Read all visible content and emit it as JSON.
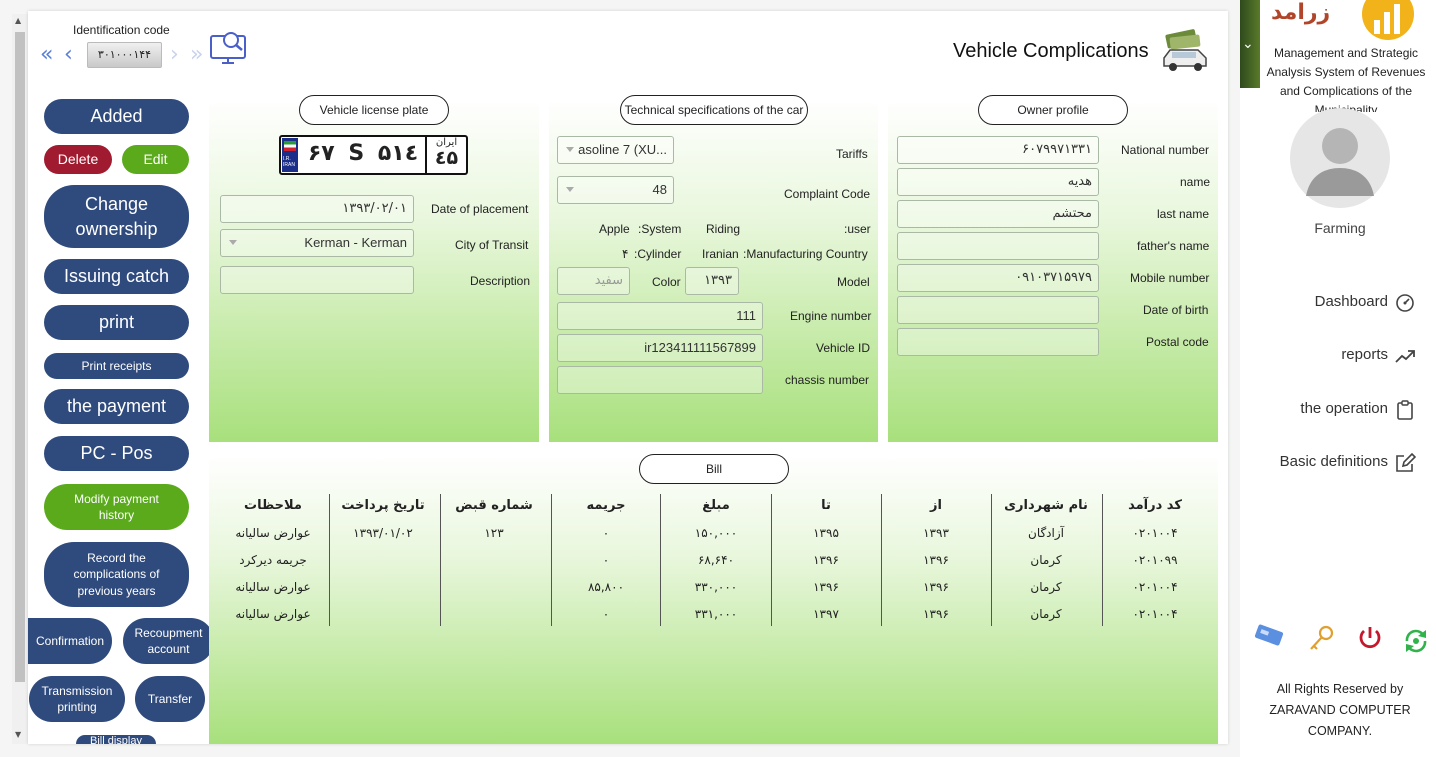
{
  "header": {
    "identification_label": "Identification code",
    "identification_value": "۳۰۱۰۰۰۱۴۴",
    "title": "Vehicle Complications"
  },
  "actions": {
    "added": "Added",
    "delete": "Delete",
    "edit": "Edit",
    "change_ownership": "Change ownership",
    "issuing_catch": "Issuing catch",
    "print": "print",
    "print_receipts": "Print receipts",
    "the_payment": "the payment",
    "pc_pos": "PC - Pos",
    "modify_payment_history": "Modify payment history",
    "record_complications": "Record the complications of previous years",
    "confirmation": "Confirmation",
    "recoupment_account": "Recoupment account",
    "transmission_printing": "Transmission printing",
    "transfer": "Transfer",
    "bill_display": "Bill display"
  },
  "plate_panel": {
    "title": "Vehicle license plate",
    "plate_num1": "۶۷",
    "plate_letter": "S",
    "plate_num2": "۵۱٤",
    "plate_region_label": "ایران",
    "plate_region": "٤۵",
    "plate_country": "I.R. IRAN",
    "date_label": "Date of placement",
    "date_value": "۱۳۹۳/۰۲/۰۱",
    "city_label": "City of Transit",
    "city_value": "Kerman - Kerman",
    "description_label": "Description",
    "description_value": ""
  },
  "tech_panel": {
    "title": "Technical specifications of the car",
    "tariffs_label": "Tariffs",
    "tariffs_value": "asoline 7 (XU...",
    "complaint_label": "Complaint Code",
    "complaint_value": "48",
    "user_label": ":user",
    "user_value": "Riding",
    "system_label": ":System",
    "system_value": "Apple",
    "country_label": ":Manufacturing Country",
    "country_value": "Iranian",
    "cylinder_label": ":Cylinder",
    "cylinder_value": "۴",
    "model_label": "Model",
    "model_value": "۱۳۹۳",
    "color_label": "Color",
    "color_value": "سفید",
    "engine_label": "Engine number",
    "engine_value": "111",
    "vehicle_id_label": "Vehicle ID",
    "vehicle_id_value": "ir123411111567899",
    "chassis_label": "chassis number",
    "chassis_value": ""
  },
  "owner_panel": {
    "title": "Owner profile",
    "national_label": "National number",
    "national_value": "۶۰۷۹۹۷۱۳۳۱",
    "name_label": "name",
    "name_value": "هدیه",
    "last_label": "last name",
    "last_value": "محتشم",
    "father_label": "father's name",
    "father_value": "",
    "mobile_label": "Mobile number",
    "mobile_value": "۰۹۱۰۳۷۱۵۹۷۹",
    "birth_label": "Date of birth",
    "birth_value": "",
    "postal_label": "Postal code",
    "postal_value": ""
  },
  "bill": {
    "title": "Bill",
    "columns": [
      "کد درآمد",
      "نام شهرداری",
      "از",
      "تا",
      "مبلغ",
      "جریمه",
      "شماره قبض",
      "تاریخ پرداخت",
      "ملاحظات"
    ],
    "rows": [
      [
        "۰۲۰۱۰۰۴",
        "آزادگان",
        "۱۳۹۳",
        "۱۳۹۵",
        "۱۵۰,۰۰۰",
        "۰",
        "۱۲۳",
        "۱۳۹۳/۰۱/۰۲",
        "عوارض سالیانه"
      ],
      [
        "۰۲۰۱۰۹۹",
        "کرمان",
        "۱۳۹۶",
        "۱۳۹۶",
        "۶۸,۶۴۰",
        "۰",
        "",
        "",
        "جریمه دیرکرد"
      ],
      [
        "۰۲۰۱۰۰۴",
        "کرمان",
        "۱۳۹۶",
        "۱۳۹۶",
        "۳۳۰,۰۰۰",
        "۸۵,۸۰۰",
        "",
        "",
        "عوارض سالیانه"
      ],
      [
        "۰۲۰۱۰۰۴",
        "کرمان",
        "۱۳۹۶",
        "۱۳۹۷",
        "۳۳۱,۰۰۰",
        "۰",
        "",
        "",
        "عوارض سالیانه"
      ]
    ]
  },
  "sidebar": {
    "logo_text": "زرامد",
    "system_title": "Management and Strategic Analysis System of Revenues and Complications of the Municipality",
    "user_name": "Farming",
    "menu": [
      {
        "label": "Dashboard",
        "icon": "dashboard-icon"
      },
      {
        "label": "reports",
        "icon": "trend-icon"
      },
      {
        "label": "the operation",
        "icon": "clipboard-icon"
      },
      {
        "label": "Basic definitions",
        "icon": "edit-icon"
      }
    ],
    "footer": "All Rights Reserved by ZARAVAND COMPUTER COMPANY.",
    "colors": {
      "navy": "#2f4a7c",
      "green": "#5aaa1c",
      "red": "#a11b30"
    }
  }
}
